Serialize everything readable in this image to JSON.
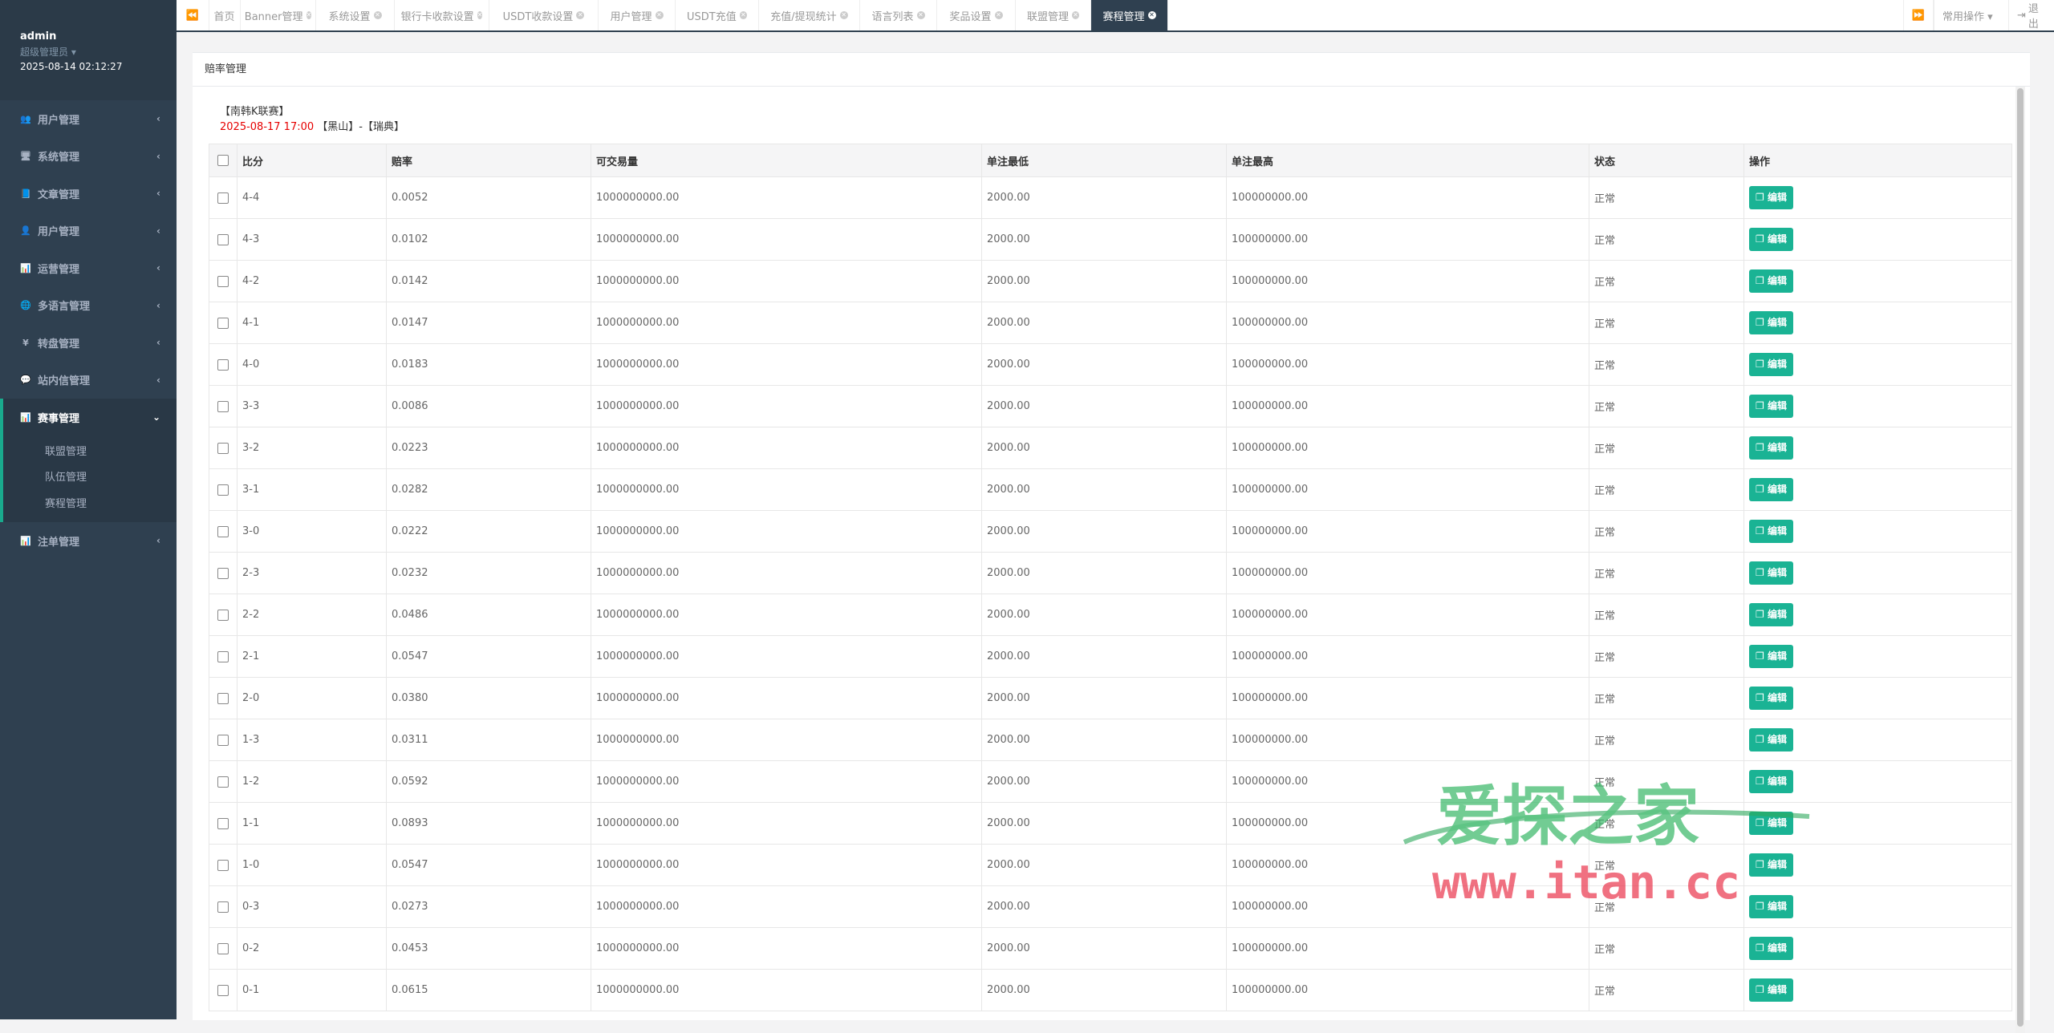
{
  "user": {
    "name": "admin",
    "role": "超级管理员 ▾",
    "datetime": "2025-08-14 02:12:27"
  },
  "sidebar": {
    "items": [
      {
        "label": "用户管理",
        "icon": "users-icon",
        "glyph": "👥"
      },
      {
        "label": "系统管理",
        "icon": "desktop-icon",
        "glyph": "🖥"
      },
      {
        "label": "文章管理",
        "icon": "book-icon",
        "glyph": "📘"
      },
      {
        "label": "用户管理",
        "icon": "user-icon",
        "glyph": "👤"
      },
      {
        "label": "运营管理",
        "icon": "bar-chart-icon",
        "glyph": "📊"
      },
      {
        "label": "多语言管理",
        "icon": "globe-icon",
        "glyph": "🌐"
      },
      {
        "label": "转盘管理",
        "icon": "yen-icon",
        "glyph": "¥"
      },
      {
        "label": "站内信管理",
        "icon": "comment-icon",
        "glyph": "💬"
      },
      {
        "label": "赛事管理",
        "icon": "bar-chart-icon",
        "glyph": "📊",
        "active": true
      },
      {
        "label": "注单管理",
        "icon": "bar-chart-icon",
        "glyph": "📊"
      }
    ],
    "subitems": [
      "联盟管理",
      "队伍管理",
      "赛程管理"
    ]
  },
  "tabs": [
    {
      "label": "首页",
      "closable": false
    },
    {
      "label": "Banner管理",
      "closable": true
    },
    {
      "label": "系统设置",
      "closable": true
    },
    {
      "label": "银行卡收款设置",
      "closable": true
    },
    {
      "label": "USDT收款设置",
      "closable": true
    },
    {
      "label": "用户管理",
      "closable": true
    },
    {
      "label": "USDT充值",
      "closable": true
    },
    {
      "label": "充值/提现统计",
      "closable": true
    },
    {
      "label": "语言列表",
      "closable": true
    },
    {
      "label": "奖品设置",
      "closable": true
    },
    {
      "label": "联盟管理",
      "closable": true
    },
    {
      "label": "赛程管理",
      "closable": true,
      "active": true
    }
  ],
  "toolbar": {
    "common_ops": "常用操作 ▾",
    "logout": "退出"
  },
  "page": {
    "title": "赔率管理",
    "match_name": "【南韩K联赛】",
    "match_time": "2025-08-17 17:00",
    "match_teams": "【黑山】-【瑞典】"
  },
  "table": {
    "headers": [
      "比分",
      "赔率",
      "可交易量",
      "单注最低",
      "单注最高",
      "状态",
      "操作"
    ],
    "edit_label": "编辑",
    "rows": [
      [
        "4-4",
        "0.0052",
        "1000000000.00",
        "2000.00",
        "100000000.00",
        "正常"
      ],
      [
        "4-3",
        "0.0102",
        "1000000000.00",
        "2000.00",
        "100000000.00",
        "正常"
      ],
      [
        "4-2",
        "0.0142",
        "1000000000.00",
        "2000.00",
        "100000000.00",
        "正常"
      ],
      [
        "4-1",
        "0.0147",
        "1000000000.00",
        "2000.00",
        "100000000.00",
        "正常"
      ],
      [
        "4-0",
        "0.0183",
        "1000000000.00",
        "2000.00",
        "100000000.00",
        "正常"
      ],
      [
        "3-3",
        "0.0086",
        "1000000000.00",
        "2000.00",
        "100000000.00",
        "正常"
      ],
      [
        "3-2",
        "0.0223",
        "1000000000.00",
        "2000.00",
        "100000000.00",
        "正常"
      ],
      [
        "3-1",
        "0.0282",
        "1000000000.00",
        "2000.00",
        "100000000.00",
        "正常"
      ],
      [
        "3-0",
        "0.0222",
        "1000000000.00",
        "2000.00",
        "100000000.00",
        "正常"
      ],
      [
        "2-3",
        "0.0232",
        "1000000000.00",
        "2000.00",
        "100000000.00",
        "正常"
      ],
      [
        "2-2",
        "0.0486",
        "1000000000.00",
        "2000.00",
        "100000000.00",
        "正常"
      ],
      [
        "2-1",
        "0.0547",
        "1000000000.00",
        "2000.00",
        "100000000.00",
        "正常"
      ],
      [
        "2-0",
        "0.0380",
        "1000000000.00",
        "2000.00",
        "100000000.00",
        "正常"
      ],
      [
        "1-3",
        "0.0311",
        "1000000000.00",
        "2000.00",
        "100000000.00",
        "正常"
      ],
      [
        "1-2",
        "0.0592",
        "1000000000.00",
        "2000.00",
        "100000000.00",
        "正常"
      ],
      [
        "1-1",
        "0.0893",
        "1000000000.00",
        "2000.00",
        "100000000.00",
        "正常"
      ],
      [
        "1-0",
        "0.0547",
        "1000000000.00",
        "2000.00",
        "100000000.00",
        "正常"
      ],
      [
        "0-3",
        "0.0273",
        "1000000000.00",
        "2000.00",
        "100000000.00",
        "正常"
      ],
      [
        "0-2",
        "0.0453",
        "1000000000.00",
        "2000.00",
        "100000000.00",
        "正常"
      ],
      [
        "0-1",
        "0.0615",
        "1000000000.00",
        "2000.00",
        "100000000.00",
        "正常"
      ]
    ]
  },
  "watermark": {
    "title": "爱探之家",
    "url": "www.itan.cc"
  },
  "colors": {
    "sidebar": "#2f4050",
    "accent": "#1ab394",
    "danger": "#e60000"
  }
}
